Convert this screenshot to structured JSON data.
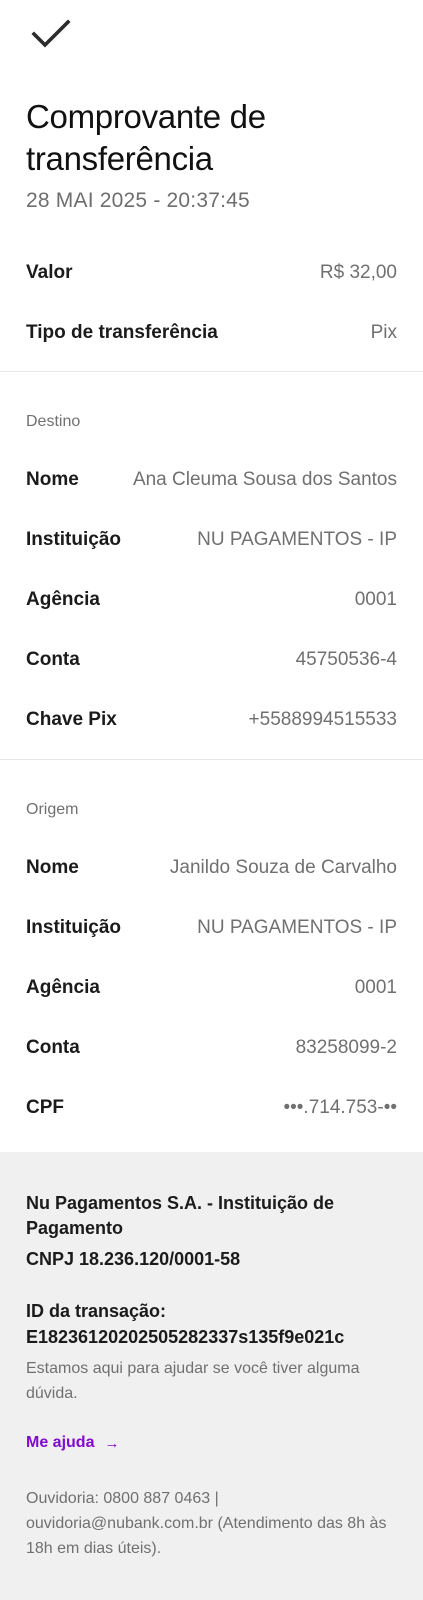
{
  "icons": {
    "done": "check-icon",
    "link_arrow": "arrow-right-icon"
  },
  "colors": {
    "accent": "#820ad1",
    "footer_bg": "#f0f0f0",
    "muted_text": "#707070"
  },
  "header": {
    "title": "Comprovante de transferência",
    "datetime": "28 MAI 2025 - 20:37:45"
  },
  "summary": [
    {
      "label": "Valor",
      "value": "R$ 32,00"
    },
    {
      "label": "Tipo de transferência",
      "value": "Pix"
    }
  ],
  "destino": {
    "heading": "Destino",
    "rows": [
      {
        "label": "Nome",
        "value": "Ana Cleuma Sousa dos Santos"
      },
      {
        "label": "Instituição",
        "value": "NU PAGAMENTOS - IP"
      },
      {
        "label": "Agência",
        "value": "0001"
      },
      {
        "label": "Conta",
        "value": "45750536-4"
      },
      {
        "label": "Chave Pix",
        "value": "+5588994515533"
      }
    ]
  },
  "origem": {
    "heading": "Origem",
    "rows": [
      {
        "label": "Nome",
        "value": "Janildo Souza de Carvalho"
      },
      {
        "label": "Instituição",
        "value": "NU PAGAMENTOS - IP"
      },
      {
        "label": "Agência",
        "value": "0001"
      },
      {
        "label": "Conta",
        "value": "83258099-2"
      },
      {
        "label": "CPF",
        "value": "•••.714.753-••"
      }
    ]
  },
  "footer": {
    "company_line1": "Nu Pagamentos S.A. - Instituição de",
    "company_line2": "Pagamento",
    "cnpj": "CNPJ 18.236.120/0001-58",
    "transaction_label": "ID da transação:",
    "transaction_id": "E18236120202505282337s135f9e021c",
    "help_text": "Estamos aqui para ajudar se você tiver alguma dúvida.",
    "help_link": "Me ajuda",
    "link_arrow": "→",
    "ombudsman": "Ouvidoria: 0800 887 0463 | ouvidoria@nubank.com.br (Atendimento das 8h às 18h em dias úteis)."
  }
}
